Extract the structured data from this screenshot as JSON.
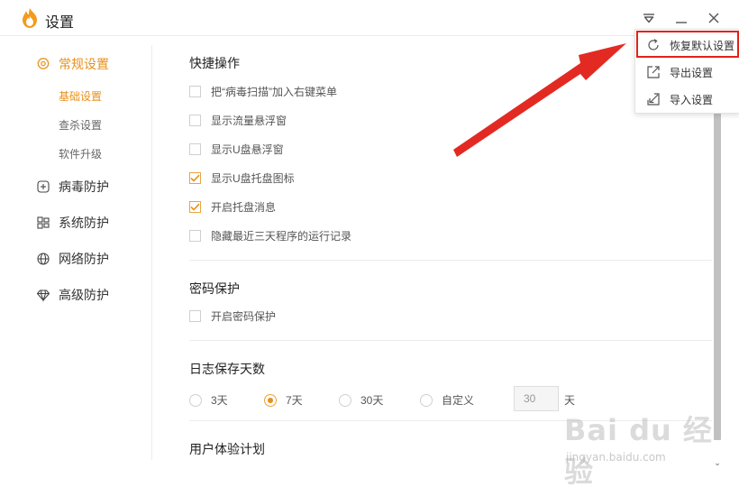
{
  "window": {
    "title": "设置"
  },
  "colors": {
    "accent": "#e8901a",
    "highlight": "#e2231a"
  },
  "sidebar": {
    "items": [
      {
        "label": "常规设置",
        "icon": "gear-icon",
        "active": true
      },
      {
        "label": "病毒防护",
        "icon": "plus-square-icon"
      },
      {
        "label": "系统防护",
        "icon": "windows-icon"
      },
      {
        "label": "网络防护",
        "icon": "globe-icon"
      },
      {
        "label": "高级防护",
        "icon": "diamond-icon"
      }
    ],
    "subitems": [
      {
        "label": "基础设置",
        "active": true
      },
      {
        "label": "查杀设置"
      },
      {
        "label": "软件升级"
      }
    ]
  },
  "sections": {
    "quick": {
      "title": "快捷操作",
      "options": [
        {
          "label": "把“病毒扫描”加入右键菜单",
          "checked": false
        },
        {
          "label": "显示流量悬浮窗",
          "checked": false
        },
        {
          "label": "显示U盘悬浮窗",
          "checked": false
        },
        {
          "label": "显示U盘托盘图标",
          "checked": true
        },
        {
          "label": "开启托盘消息",
          "checked": true
        },
        {
          "label": "隐藏最近三天程序的运行记录",
          "checked": false
        }
      ]
    },
    "password": {
      "title": "密码保护",
      "options": [
        {
          "label": "开启密码保护",
          "checked": false
        }
      ]
    },
    "log": {
      "title": "日志保存天数",
      "radios": [
        {
          "label": "3天",
          "selected": false
        },
        {
          "label": "7天",
          "selected": true
        },
        {
          "label": "30天",
          "selected": false
        },
        {
          "label": "自定义",
          "selected": false
        }
      ],
      "custom_value": "30",
      "unit": "天"
    },
    "ux": {
      "title": "用户体验计划"
    }
  },
  "menu": {
    "items": [
      {
        "label": "恢复默认设置",
        "icon": "refresh-icon"
      },
      {
        "label": "导出设置",
        "icon": "export-icon"
      },
      {
        "label": "导入设置",
        "icon": "import-icon"
      }
    ]
  },
  "watermark": {
    "text": "Bai du 经验",
    "url": "jingyan.baidu.com"
  }
}
